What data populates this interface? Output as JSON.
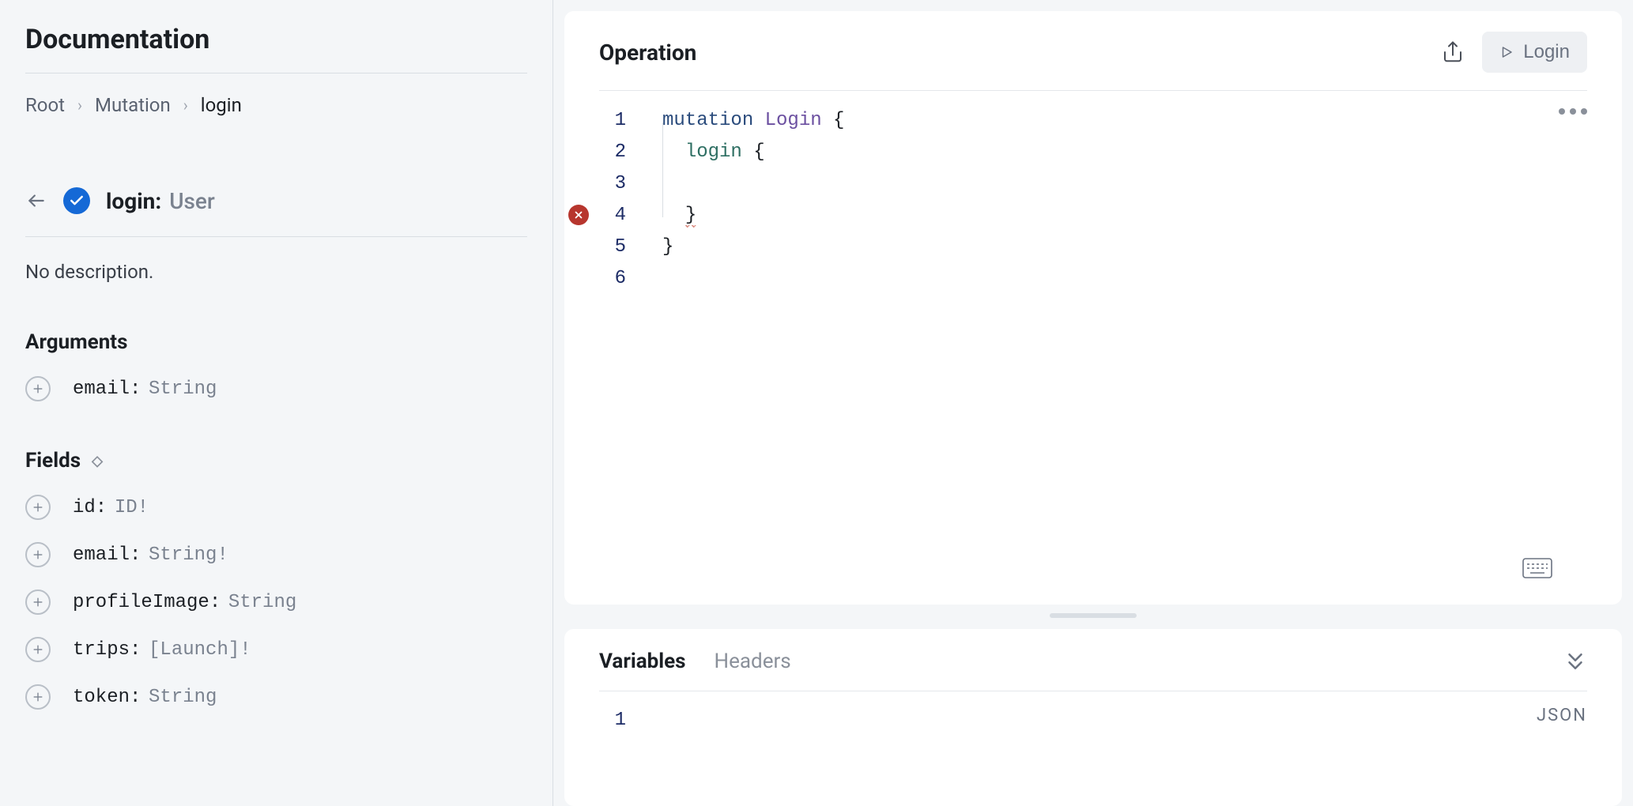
{
  "documentation": {
    "title": "Documentation",
    "breadcrumbs": [
      "Root",
      "Mutation",
      "login"
    ],
    "field": {
      "name": "login:",
      "type": "User"
    },
    "no_description": "No description.",
    "sections": {
      "arguments": {
        "heading": "Arguments",
        "items": [
          {
            "name": "email:",
            "type": "String"
          }
        ]
      },
      "fields": {
        "heading": "Fields",
        "items": [
          {
            "name": "id:",
            "type": "ID!"
          },
          {
            "name": "email:",
            "type": "String!"
          },
          {
            "name": "profileImage:",
            "type": "String"
          },
          {
            "name": "trips:",
            "type": "[Launch]!"
          },
          {
            "name": "token:",
            "type": "String"
          }
        ]
      }
    }
  },
  "operation": {
    "heading": "Operation",
    "run_label": "Login",
    "code_tokens": {
      "l1_kw": "mutation",
      "l1_name": "Login",
      "l1_brace": "{",
      "l2_field": "login",
      "l2_brace": "{",
      "l4_brace": "}",
      "l5_brace": "}"
    },
    "line_numbers": [
      "1",
      "2",
      "3",
      "4",
      "5",
      "6"
    ],
    "error_line": 4
  },
  "variables": {
    "tabs": {
      "variables": "Variables",
      "headers": "Headers"
    },
    "line_numbers": [
      "1"
    ],
    "format_badge": "JSON"
  }
}
